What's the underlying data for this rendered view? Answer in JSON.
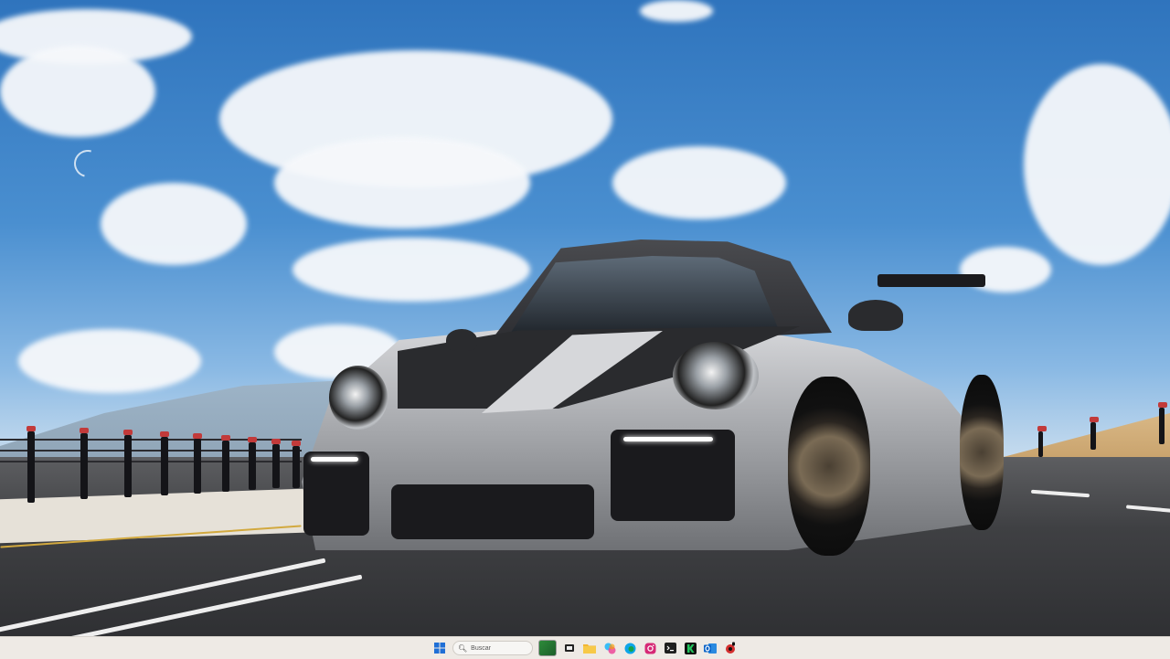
{
  "wallpaper": {
    "subject": "silver-sports-car-on-track",
    "sky_color": "#3a83c9"
  },
  "taskbar": {
    "search_placeholder": "Buscar",
    "icons": [
      "start-icon",
      "search-icon",
      "widget-photo-icon",
      "task-view-icon",
      "file-explorer-icon",
      "copilot-icon",
      "edge-icon",
      "instagram-icon",
      "terminal-icon",
      "kick-icon",
      "outlook-icon",
      "media-app-icon"
    ],
    "accent_colors": {
      "start": "#1f6fd6",
      "instagram": "#d62976",
      "kick": "#22c55e",
      "outlook": "#0a64c8",
      "folder": "#f2b632"
    }
  }
}
